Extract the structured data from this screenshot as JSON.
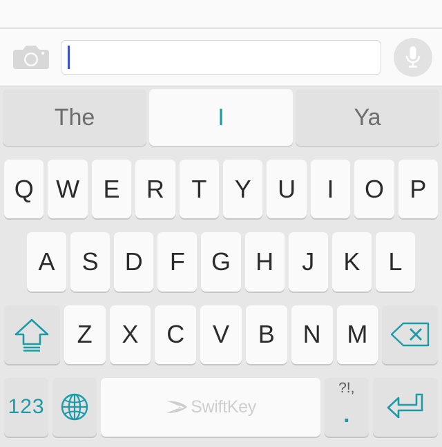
{
  "app": {
    "name": "SwiftKey Keyboard",
    "accent_color": "#1d9aa8",
    "caret_color": "#3b4fd6",
    "key_bg": "#fafafa",
    "keyboard_bg": "#e7e7e7",
    "fn_key_bg": "#e2e2e2"
  },
  "input_bar": {
    "camera_icon": "camera-icon",
    "mic_icon": "microphone-icon",
    "field_value": "",
    "field_placeholder": "",
    "caret_visible": true
  },
  "suggestions": {
    "items": [
      {
        "label": "The",
        "active": false
      },
      {
        "label": "I",
        "active": true
      },
      {
        "label": "Ya",
        "active": false
      }
    ]
  },
  "keyboard": {
    "row1": [
      "Q",
      "W",
      "E",
      "R",
      "T",
      "Y",
      "U",
      "I",
      "O",
      "P"
    ],
    "row2": [
      "A",
      "S",
      "D",
      "F",
      "G",
      "H",
      "J",
      "K",
      "L"
    ],
    "row3_letters": [
      "Z",
      "X",
      "C",
      "V",
      "B",
      "N",
      "M"
    ],
    "shift": {
      "icon": "shift-caps-lock-icon",
      "label": ""
    },
    "backspace": {
      "icon": "backspace-delete-icon",
      "label": ""
    },
    "row4": {
      "numbers": {
        "label": "123",
        "icon": "numeric-mode-icon"
      },
      "globe": {
        "icon": "globe-language-icon",
        "label": ""
      },
      "space": {
        "brand": "SwiftKey",
        "icon": "swiftkey-logo-icon"
      },
      "period": {
        "alt_label": "?!,",
        "label": "."
      },
      "enter": {
        "icon": "return-enter-icon",
        "label": ""
      }
    }
  }
}
